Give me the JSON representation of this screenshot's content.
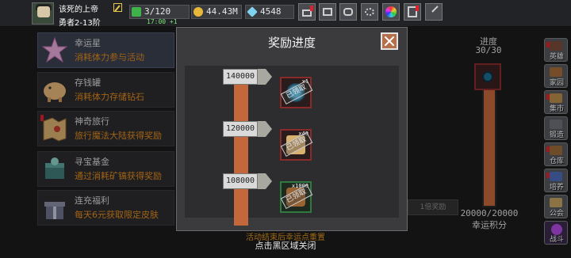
{
  "player": {
    "name": "该死的上帝",
    "rank": "勇者2-13阶"
  },
  "resources": {
    "stamina": "3/120",
    "stamina_regen": "17:00 +1",
    "gold": "44.43M",
    "gems": "4548"
  },
  "top_buttons": [
    "shop-icon",
    "mail-icon",
    "gamepad-icon",
    "gear-icon",
    "color-wheel-icon",
    "announcement-icon",
    "swords-icon"
  ],
  "events": [
    {
      "title": "幸运星",
      "desc": "消耗体力参与活动",
      "icon": "star-icon",
      "active": true
    },
    {
      "title": "存钱罐",
      "desc": "消耗体力存储钻石",
      "icon": "piggy-bank-icon",
      "active": false
    },
    {
      "title": "神奇旅行",
      "desc": "旅行魔法大陆获得奖励",
      "icon": "map-icon",
      "active": false
    },
    {
      "title": "寻宝基金",
      "desc": "通过消耗矿镐获得奖励",
      "icon": "treasure-icon",
      "active": false
    },
    {
      "title": "连充福利",
      "desc": "每天6元获取限定皮肤",
      "icon": "gift-icon",
      "active": false
    }
  ],
  "progress": {
    "label": "进度",
    "count": "30/30",
    "score": "20000/20000",
    "score_label": "幸运积分",
    "bg_button": "1倍奖励"
  },
  "side_menu": [
    {
      "label": "英雄",
      "icon": "hero-icon"
    },
    {
      "label": "家园",
      "icon": "home-icon"
    },
    {
      "label": "集市",
      "icon": "market-icon"
    },
    {
      "label": "锻造",
      "icon": "anvil-icon"
    },
    {
      "label": "仓库",
      "icon": "warehouse-icon"
    },
    {
      "label": "培养",
      "icon": "training-icon"
    },
    {
      "label": "公会",
      "icon": "guild-icon"
    },
    {
      "label": "战斗",
      "icon": "battle-portal-icon"
    }
  ],
  "modal": {
    "title": "奖励进度",
    "milestones": [
      {
        "value": "140000",
        "reward_qty": "x1",
        "claimed": "已领取",
        "reward_icon": "portal-orb-icon"
      },
      {
        "value": "120000",
        "reward_qty": "x40",
        "claimed": "已领取",
        "reward_icon": "scroll-icon"
      },
      {
        "value": "108000",
        "reward_qty": "x1000",
        "claimed": "已领取",
        "reward_icon": "wood-icon"
      }
    ]
  },
  "hints": {
    "close": "点击黑区域关闭",
    "dim": "活动结束后幸运点重置"
  },
  "colors": {
    "accent_orange": "#e08a1e",
    "track": "#c4673b",
    "badge_red": "#e0202b"
  }
}
